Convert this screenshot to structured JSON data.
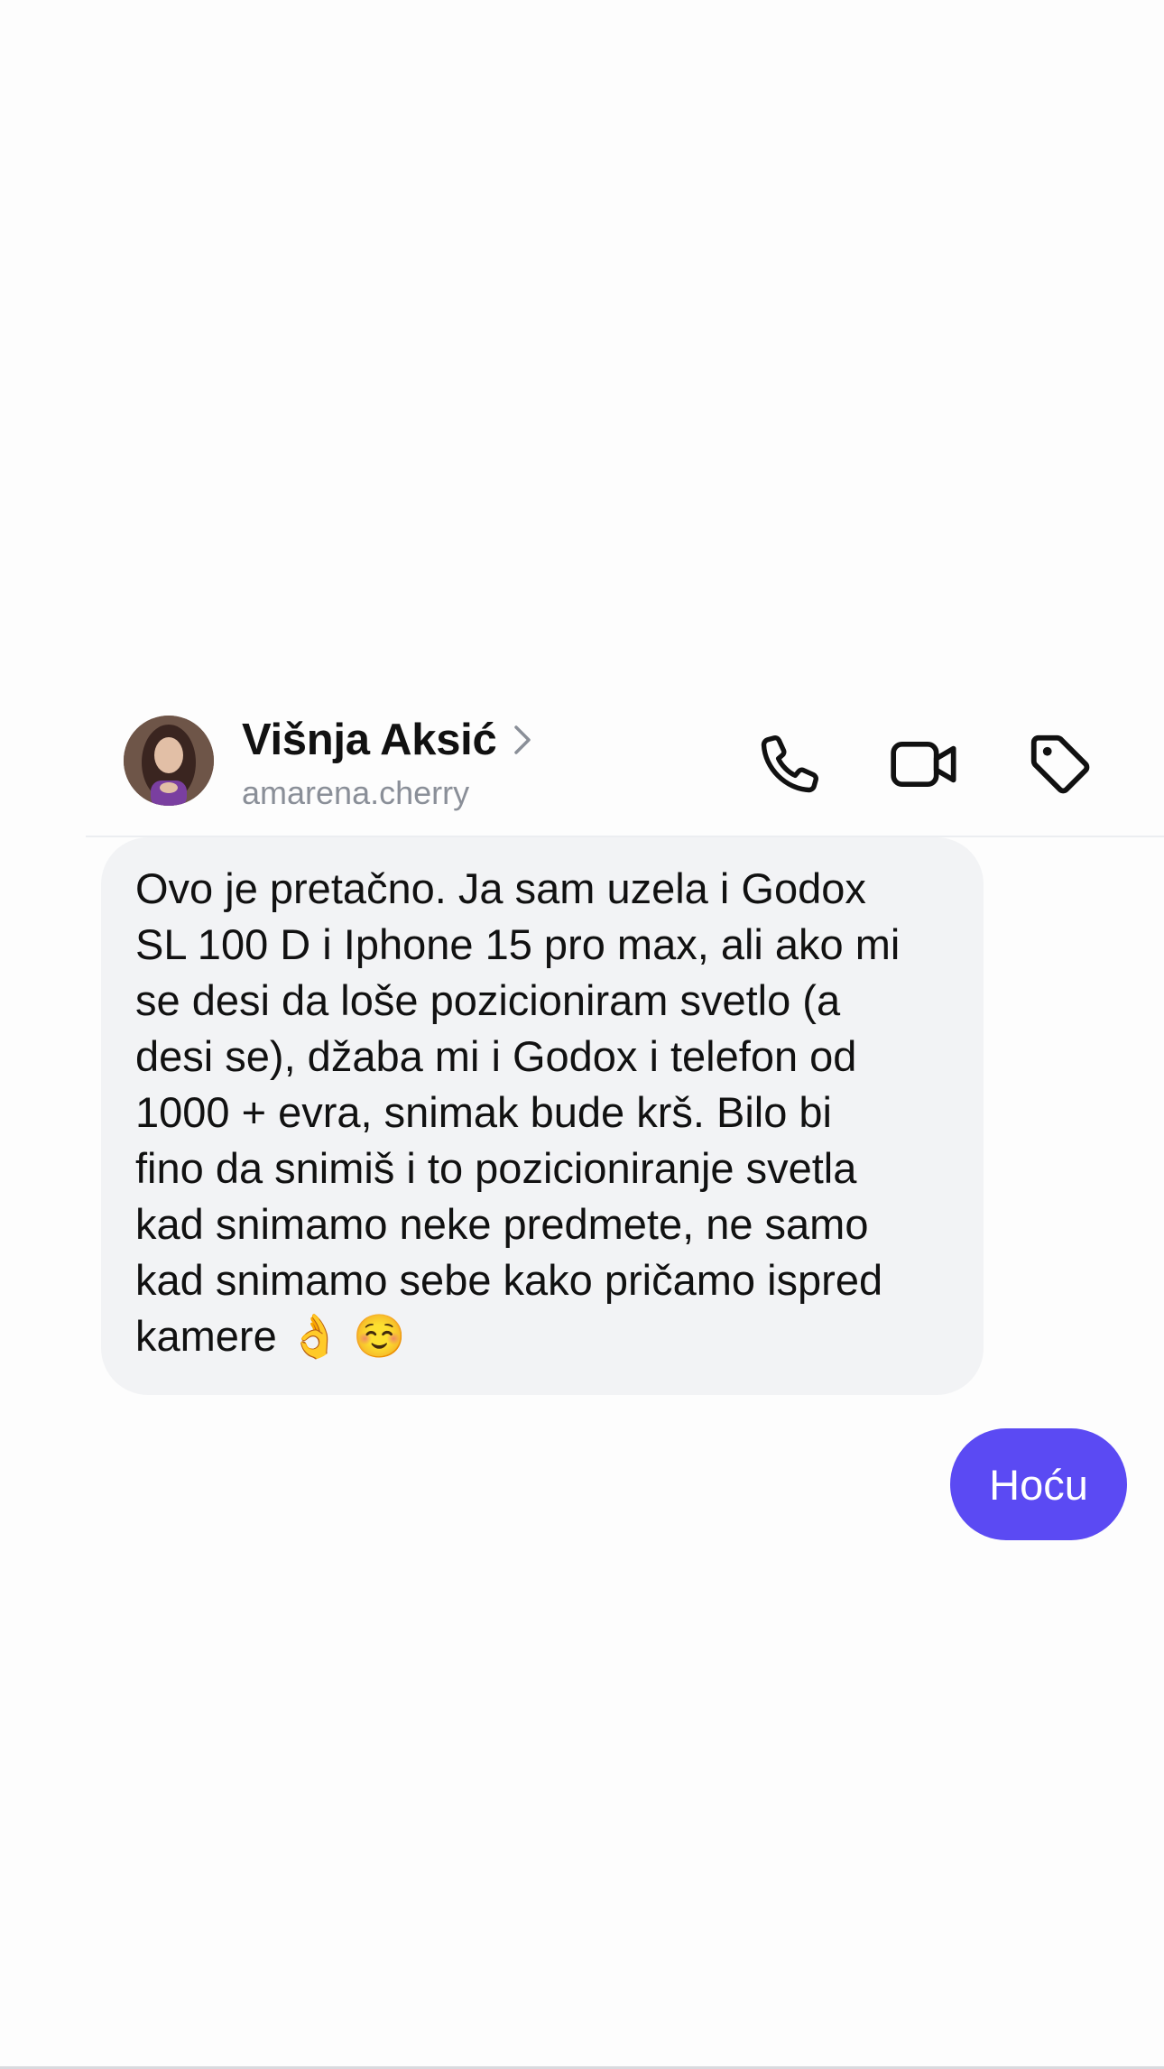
{
  "header": {
    "contact_name": "Višnja Aksić",
    "contact_handle": "amarena.cherry",
    "icons": {
      "avatar": "profile-photo",
      "chevron": "chevron-right-icon",
      "call": "phone-icon",
      "video": "video-camera-icon",
      "tag": "tag-icon"
    }
  },
  "messages": [
    {
      "direction": "incoming",
      "text": "Ovo je pretačno. Ja sam uzela i Godox\nSL 100 D i Iphone 15 pro max, ali ako mi\nse desi da loše pozicioniram svetlo (a\ndesi se), džaba mi i Godox i telefon od\n1000 + evra, snimak bude krš. Bilo bi\nfino da snimiš i to pozicioniranje svetla\nkad snimamo neke predmete, ne samo\nkad snimamo sebe kako pričamo ispred\nkamere 👌 ☺️"
    },
    {
      "direction": "outgoing",
      "text": "Hoću"
    }
  ],
  "colors": {
    "background": "#fdfdfd",
    "incoming_bubble": "#f2f3f5",
    "outgoing_bubble": "#5b4af3",
    "handle_text": "#8a8f98",
    "icon_stroke": "#111111"
  }
}
